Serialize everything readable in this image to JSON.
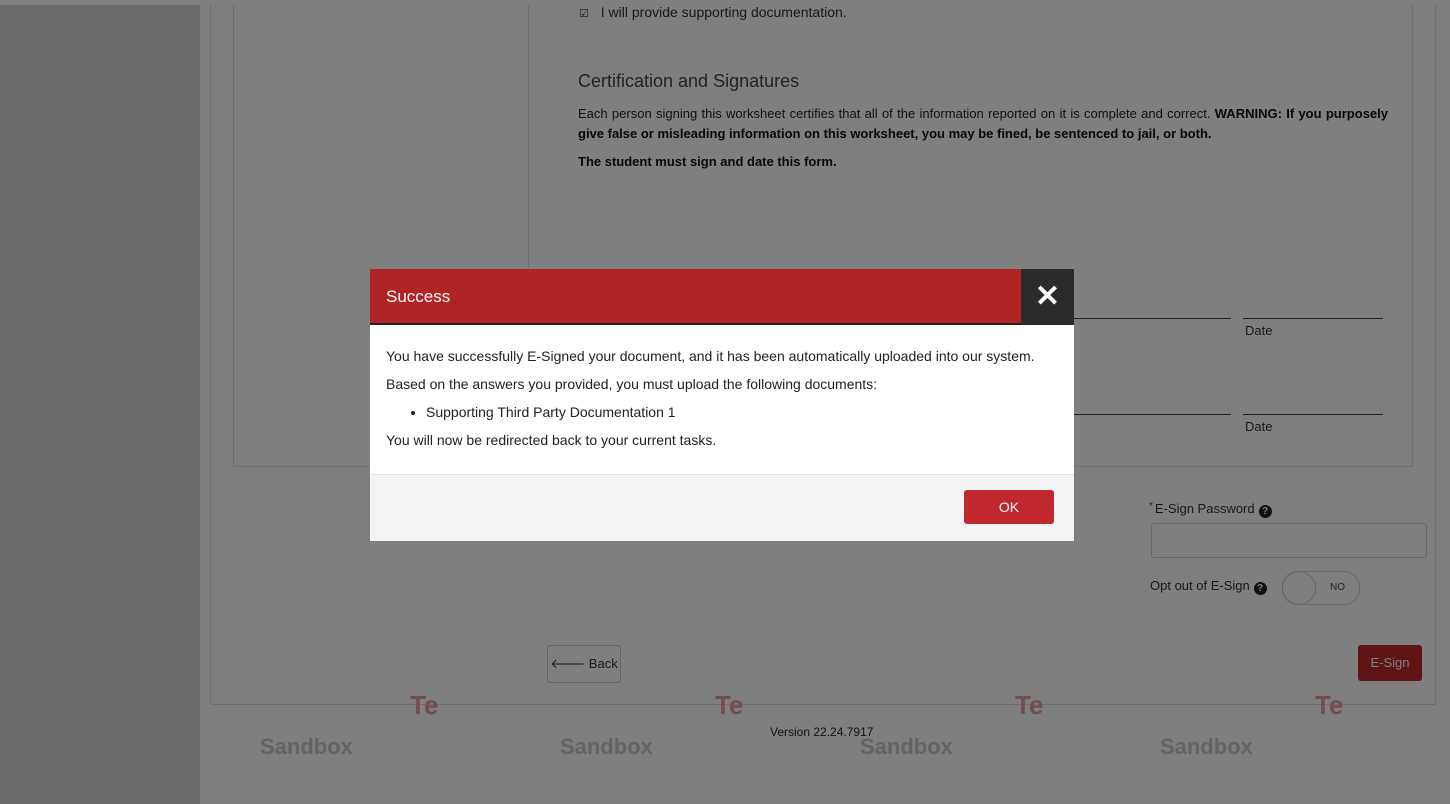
{
  "worksheet": {
    "checkbox_text": "I will provide supporting documentation.",
    "checkbox_glyph": "☑",
    "cert_heading": "Certification and Signatures",
    "cert_text": "Each person signing this worksheet certifies that all of the information reported on it is complete and correct. ",
    "cert_warning": "WARNING: If you purposely give false or misleading information on this worksheet, you may be fined, be sentenced to jail, or both.",
    "student_note": "The student must sign and date this form.",
    "date_label_1": "Date",
    "date_label_2": "Date"
  },
  "esign": {
    "password_label": "E-Sign Password",
    "password_required_mark": "*",
    "password_value": "",
    "help_icon": "question-circle-icon",
    "opt_out_label": "Opt out of E-Sign",
    "toggle_state": "NO",
    "toggle_on": false
  },
  "nav": {
    "back_arrow": "🡐",
    "back_label": "Back",
    "esign_label": "E-Sign"
  },
  "footer": {
    "version": "Version 22.24.7917",
    "watermark": "Sandbox"
  },
  "modal": {
    "title": "Success",
    "close_glyph": "✕",
    "line1": "You have successfully E-Signed your document, and it has been automatically uploaded into our system.",
    "line2": "Based on the answers you provided, you must upload the following documents:",
    "documents": [
      "Supporting Third Party Documentation 1"
    ],
    "line3": "You will now be redirected back to your current tasks.",
    "ok_label": "OK"
  },
  "colors": {
    "accent_red": "#c0282d",
    "header_red": "#b22325",
    "close_bg": "#2b2b2b"
  }
}
